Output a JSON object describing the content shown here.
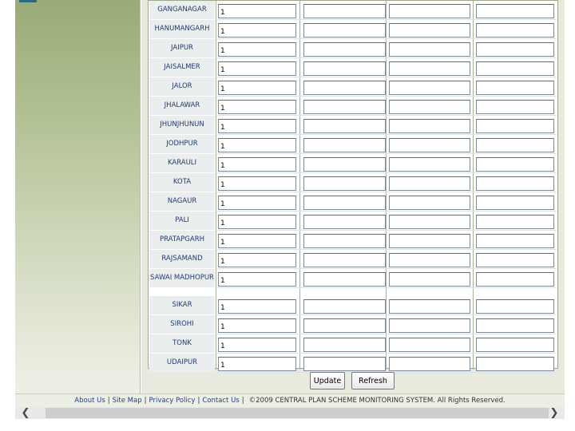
{
  "districts": [
    {
      "name": "GANGANAGAR",
      "value": "1"
    },
    {
      "name": "HANUMANGARH",
      "value": "1"
    },
    {
      "name": "JAIPUR",
      "value": "1"
    },
    {
      "name": "JAISALMER",
      "value": "1"
    },
    {
      "name": "JALOR",
      "value": "1"
    },
    {
      "name": "JHALAWAR",
      "value": "1"
    },
    {
      "name": "JHUNJHUNUN",
      "value": "1"
    },
    {
      "name": "JODHPUR",
      "value": "1"
    },
    {
      "name": "KARAULI",
      "value": "1"
    },
    {
      "name": "KOTA",
      "value": "1"
    },
    {
      "name": "NAGAUR",
      "value": "1"
    },
    {
      "name": "PALI",
      "value": "1"
    },
    {
      "name": "PRATAPGARH",
      "value": "1"
    },
    {
      "name": "RAJSAMAND",
      "value": "1"
    },
    {
      "name": "SAWAI MADHOPUR",
      "value": "1"
    },
    {
      "name": "SIKAR",
      "value": "1"
    },
    {
      "name": "SIROHI",
      "value": "1"
    },
    {
      "name": "TONK",
      "value": "1"
    },
    {
      "name": "UDAIPUR",
      "value": "1"
    }
  ],
  "buttons": {
    "update": "Update",
    "refresh": "Refresh"
  },
  "footer": {
    "links": [
      "About Us",
      "Site Map",
      "Privacy Policy",
      "Contact Us"
    ],
    "separator": "|",
    "copyright": "©2009 CENTRAL PLAN SCHEME MONITORING SYSTEM. All Rights Reserved."
  },
  "scrollbar": {
    "left_arrow": "❮",
    "right_arrow": "❯"
  }
}
